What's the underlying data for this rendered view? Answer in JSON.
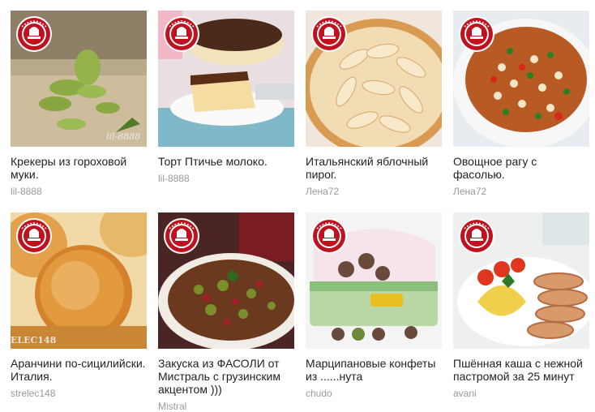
{
  "recipes": [
    {
      "title": "Крекеры из гороховой муки.",
      "author": "lil-8888",
      "watermark": "lil-8888"
    },
    {
      "title": "Торт Птичье молоко.",
      "author": "lil-8888"
    },
    {
      "title": "Итальянский яблочный пирог.",
      "author": "Лена72"
    },
    {
      "title": "Овощное рагу с фасолью.",
      "author": "Лена72"
    },
    {
      "title": "Аранчини по-сицилийски. Италия.",
      "author": "strelec148",
      "watermark": "ELEC148"
    },
    {
      "title": "Закуска из ФАСОЛИ от Мистраль с грузинским акцентом )))",
      "author": "Mistral"
    },
    {
      "title": "Марципановые конфеты из ......нута",
      "author": "chudo"
    },
    {
      "title": "Пшённая каша с нежной пастромой за 25 минут",
      "author": "avani"
    }
  ],
  "colors": {
    "badge_red": "#c0121e",
    "text": "#222222",
    "author": "#9a9a9a"
  }
}
